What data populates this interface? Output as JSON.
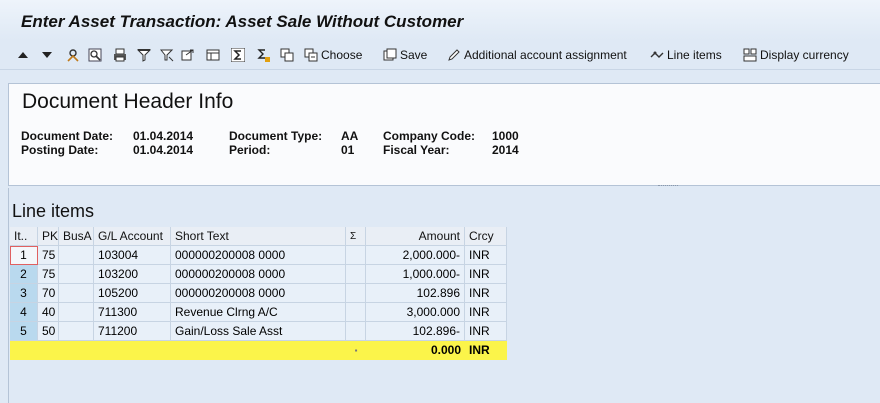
{
  "window": {
    "title": "Enter Asset Transaction: Asset Sale Without Customer"
  },
  "toolbar": {
    "choose_label": "Choose",
    "save_label": "Save",
    "additional_label": "Additional account assignment",
    "line_items_label": "Line items",
    "display_currency_label": "Display currency"
  },
  "header": {
    "title": "Document Header Info",
    "document_date_label": "Document Date:",
    "document_date_value": "01.04.2014",
    "posting_date_label": "Posting Date:",
    "posting_date_value": "01.04.2014",
    "document_type_label": "Document Type:",
    "document_type_value": "AA",
    "period_label": "Period:",
    "period_value": "01",
    "company_code_label": "Company Code:",
    "company_code_value": "1000",
    "fiscal_year_label": "Fiscal Year:",
    "fiscal_year_value": "2014"
  },
  "line_items": {
    "title": "Line items",
    "columns": [
      "It..",
      "PK",
      "BusA",
      "G/L Account",
      "Short Text",
      "Σ",
      "Amount",
      "Crcy"
    ],
    "rows": [
      {
        "item": "1",
        "pk": "75",
        "busa": "",
        "gl": "103004",
        "text": "000000200008 0000",
        "amount": "2,000.000-",
        "crcy": "INR"
      },
      {
        "item": "2",
        "pk": "75",
        "busa": "",
        "gl": "103200",
        "text": "000000200008 0000",
        "amount": "1,000.000-",
        "crcy": "INR"
      },
      {
        "item": "3",
        "pk": "70",
        "busa": "",
        "gl": "105200",
        "text": "000000200008 0000",
        "amount": "102.896",
        "crcy": "INR"
      },
      {
        "item": "4",
        "pk": "40",
        "busa": "",
        "gl": "711300",
        "text": "Revenue Clrng A/C",
        "amount": "3,000.000",
        "crcy": "INR"
      },
      {
        "item": "5",
        "pk": "50",
        "busa": "",
        "gl": "711200",
        "text": "Gain/Loss Sale Asst",
        "amount": "102.896-",
        "crcy": "INR"
      }
    ],
    "total": {
      "marker": "▪",
      "amount": "0.000",
      "crcy": "INR"
    }
  },
  "icons": [
    "arrow-up-icon",
    "arrow-down-icon",
    "find-icon",
    "find-next-icon",
    "print-icon",
    "filter-icon",
    "filter-set-icon",
    "export-icon",
    "layout-icon",
    "sum-icon",
    "subtotal-icon",
    "details-icon",
    "choose-icon",
    "save-icon",
    "pencil-icon",
    "line-items-icon",
    "display-currency-icon"
  ],
  "colors": {
    "background": "#dfe9f5",
    "total_row": "#fbf44a",
    "selected_row_marker": "#b9d9ee"
  }
}
